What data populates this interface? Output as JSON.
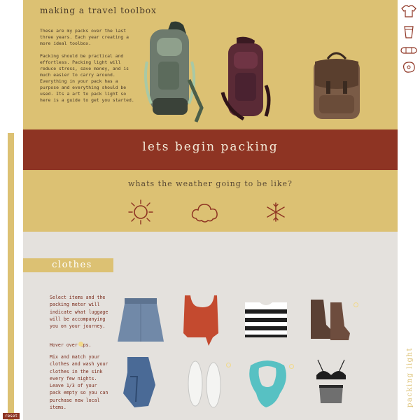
{
  "header": {
    "title": "making a travel toolbox",
    "intro_p1": "These are my packs over the last three years. Each year creating a more ideal toolbox.",
    "intro_p2": "Packing should be practical and effortless. Packing light will reduce stress, save money, and is much easier to carry around. Everything in your pack has a purpose and everything should be used. Its a art to pack light so here is a guide to get you started."
  },
  "packs": [
    "green-hiking-backpack",
    "maroon-hiking-backpack",
    "leather-rucksack"
  ],
  "banner": {
    "title": "lets begin packing"
  },
  "weather": {
    "question": "whats the weather going to be like?",
    "options": [
      "sun-icon",
      "cloud-icon",
      "snowflake-icon"
    ]
  },
  "clothes": {
    "label": "clothes",
    "instructions": "Select items and the packing meter will indicate what luggage will be accompanying you on your journey.",
    "tip_hover": "Hover over  ips.",
    "tip_mix": "Mix and match your clothes and wash your clothes in the sink every few nights. Leave 1/3 of your pack empty so you can purchase new local items.",
    "items": [
      "denim-skirt",
      "red-tank-top",
      "striped-crop-top",
      "brown-boots",
      "jeans",
      "white-flip-flops",
      "teal-scarf",
      "black-bra-set"
    ]
  },
  "sidebar_icons": [
    "shirt-icon",
    "cup-icon",
    "bandage-icon",
    "steak-icon"
  ],
  "side_label": "packing light",
  "reset_label": "reset",
  "colors": {
    "mustard": "#dcc173",
    "rust": "#8e3423",
    "gray": "#e4e1dd"
  }
}
